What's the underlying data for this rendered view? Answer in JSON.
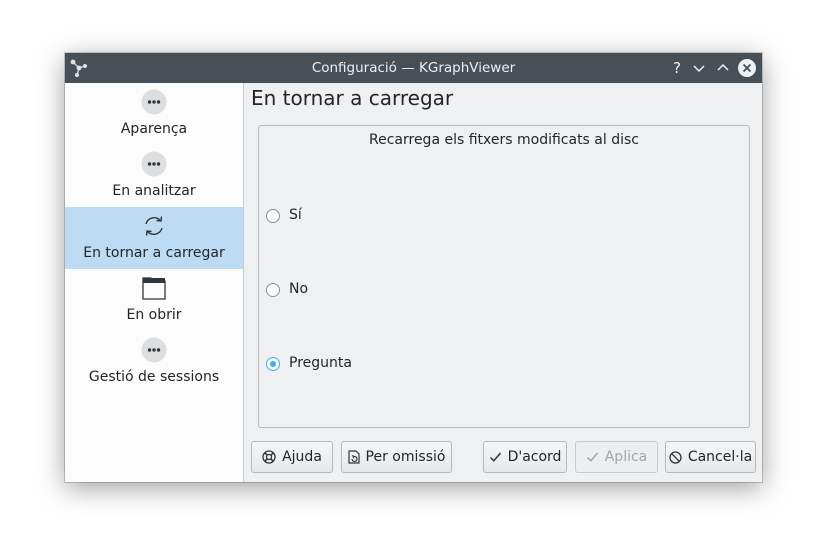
{
  "window": {
    "title": "Configuració — KGraphViewer",
    "help_glyph": "?"
  },
  "sidebar": {
    "items": [
      {
        "label": "Aparença",
        "icon": "more-dots-icon",
        "selected": false
      },
      {
        "label": "En analitzar",
        "icon": "more-dots-icon",
        "selected": false
      },
      {
        "label": "En tornar a carregar",
        "icon": "reload-icon",
        "selected": true
      },
      {
        "label": "En obrir",
        "icon": "folder-icon",
        "selected": false
      },
      {
        "label": "Gestió de sessions",
        "icon": "more-dots-icon",
        "selected": false
      }
    ]
  },
  "page": {
    "title": "En tornar a carregar",
    "group_title": "Recarrega els fitxers modificats al disc",
    "options": [
      {
        "label": "Sí",
        "checked": false
      },
      {
        "label": "No",
        "checked": false
      },
      {
        "label": "Pregunta",
        "checked": true
      }
    ]
  },
  "buttons": {
    "help": "Ajuda",
    "defaults": "Per omissió",
    "ok": "D'acord",
    "apply": "Aplica",
    "cancel": "Cancel·la"
  },
  "colors": {
    "titlebar": "#475057",
    "selection": "#bddcf4",
    "accent": "#3daee9"
  }
}
